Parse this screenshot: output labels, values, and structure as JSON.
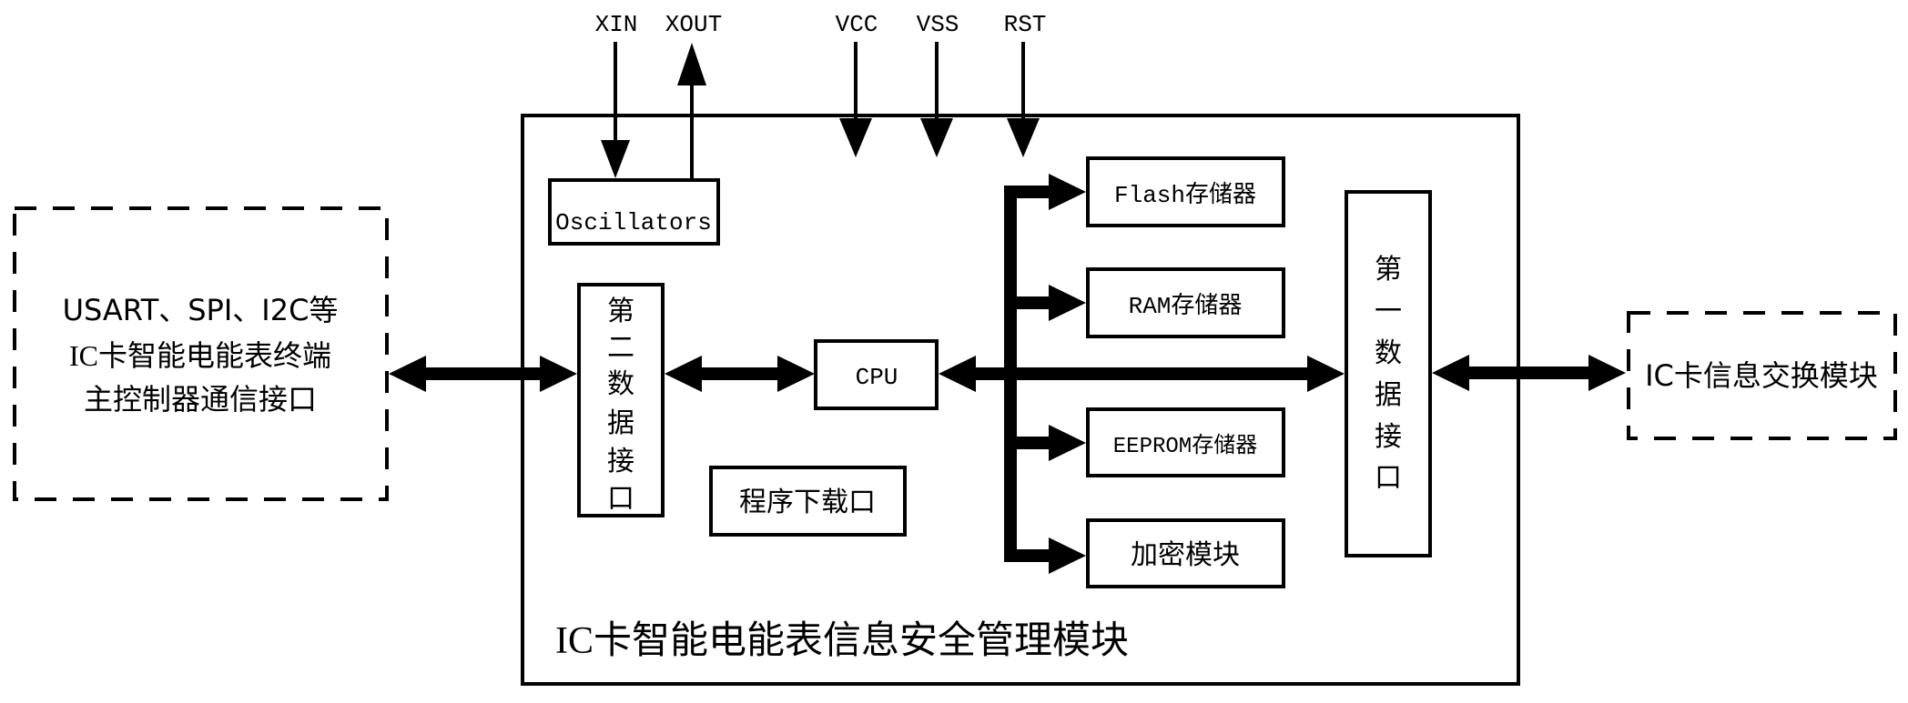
{
  "diagram": {
    "title": "IC卡智能电能表信息安全管理模块",
    "pins": {
      "xin": "XIN",
      "xout": "XOUT",
      "vcc": "VCC",
      "vss": "VSS",
      "rst": "RST"
    },
    "blocks": {
      "oscillators": "Oscillators",
      "cpu": "CPU",
      "program_download": "程序下载口",
      "flash": "Flash存储器",
      "ram": "RAM存储器",
      "eeprom": "EEPROM存储器",
      "encryption": "加密模块",
      "second_data_interface": [
        "第",
        "二",
        "数",
        "据",
        "接",
        "口"
      ],
      "first_data_interface": [
        "第",
        "一",
        "数",
        "据",
        "接",
        "口"
      ]
    },
    "external": {
      "left_lines": [
        "USART、SPI、I2C等",
        "IC卡智能电能表终端",
        "主控制器通信接口"
      ],
      "right": "IC卡信息交换模块"
    },
    "colors": {
      "stroke": "#000000",
      "background": "#ffffff"
    }
  }
}
